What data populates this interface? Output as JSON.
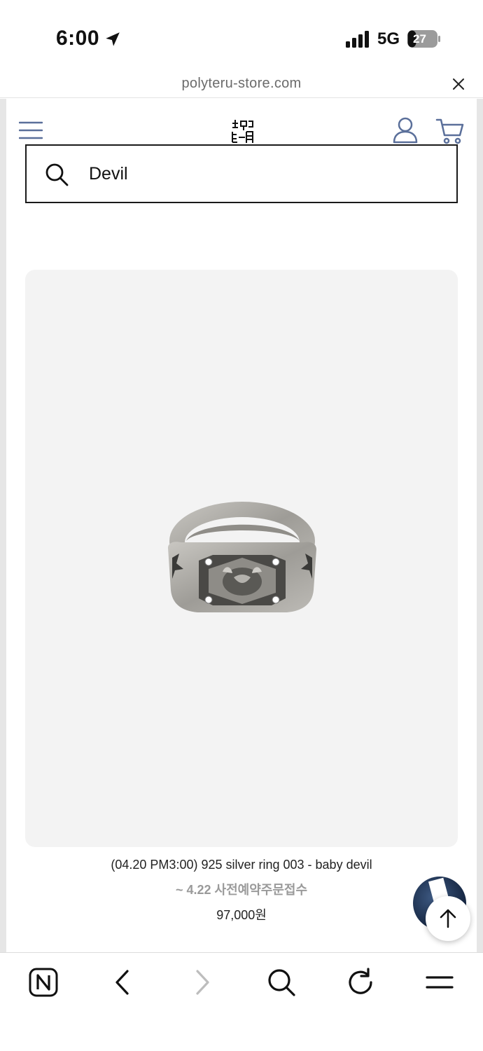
{
  "status_bar": {
    "time": "6:00",
    "network": "5G",
    "battery": "27",
    "icons": [
      "location-arrow-icon",
      "signal-icon",
      "battery-icon"
    ]
  },
  "browser": {
    "url": "polyteru-store.com",
    "close_icon": "close-icon"
  },
  "site_header": {
    "menu_icon": "hamburger-menu-icon",
    "logo_icon": "polyteru-logo",
    "user_icon": "user-icon",
    "cart_icon": "cart-icon",
    "accent_color": "#5a6f9a"
  },
  "search": {
    "icon": "search-icon",
    "value": "Devil"
  },
  "product": {
    "image_icon": "silver-ring-image",
    "name": "(04.20 PM3:00) 925 silver ring 003 - baby devil",
    "note": "~ 4.22 사전예약주문접수",
    "price": "97,000원"
  },
  "floating": {
    "badge_icon": "chat-badge-icon",
    "scroll_top_icon": "arrow-up-icon"
  },
  "toolbar": {
    "icons": [
      "naver-home-icon",
      "back-icon",
      "forward-icon",
      "search-icon",
      "reload-icon",
      "menu-icon"
    ]
  }
}
